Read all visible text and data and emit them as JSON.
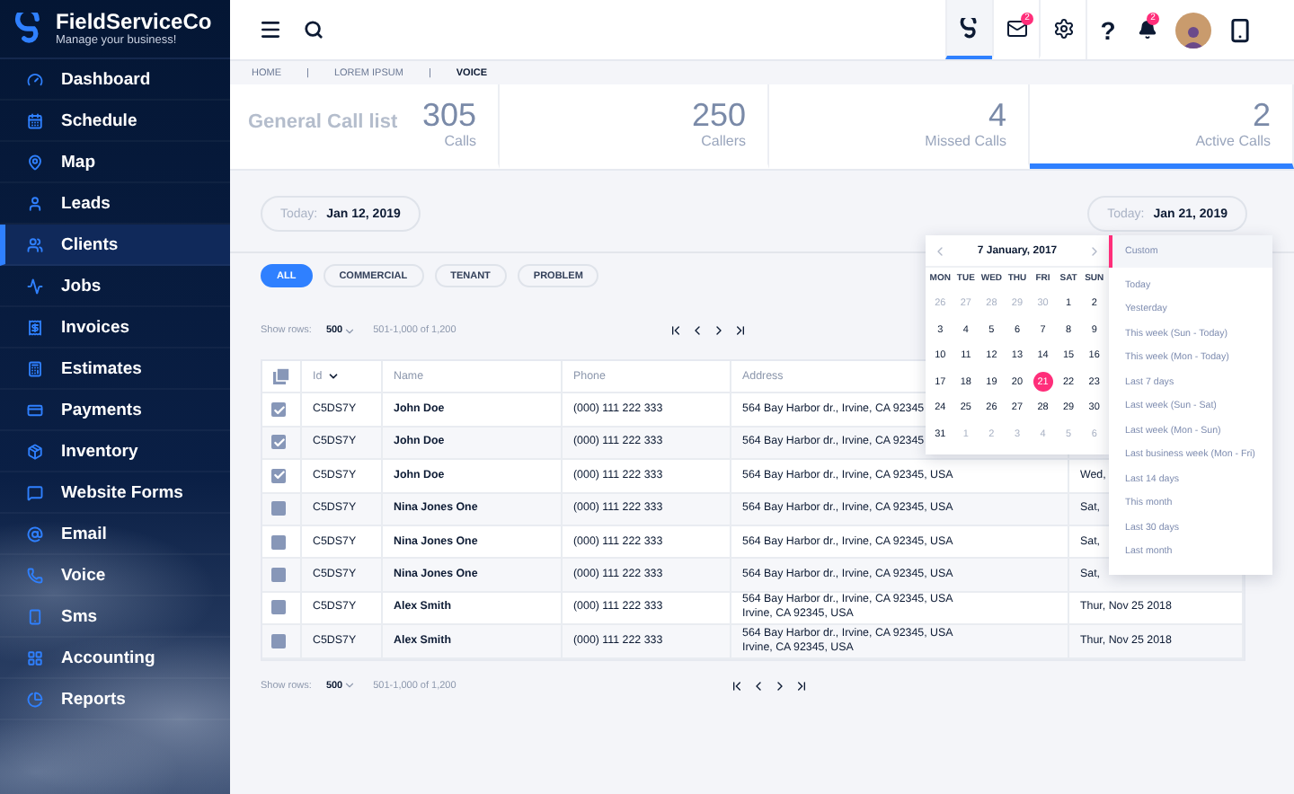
{
  "brand": {
    "name": "FieldServiceCo",
    "tagline": "Manage your business!"
  },
  "sidebar": {
    "items": [
      {
        "label": "Dashboard",
        "selected": false
      },
      {
        "label": "Schedule",
        "selected": false
      },
      {
        "label": "Map",
        "selected": false
      },
      {
        "label": "Leads",
        "selected": false
      },
      {
        "label": "Clients",
        "selected": true
      },
      {
        "label": "Jobs",
        "selected": false
      },
      {
        "label": "Invoices",
        "selected": false
      },
      {
        "label": "Estimates",
        "selected": false
      },
      {
        "label": "Payments",
        "selected": false
      },
      {
        "label": "Inventory",
        "selected": false
      },
      {
        "label": "Website Forms",
        "selected": false
      },
      {
        "label": "Email",
        "selected": false
      },
      {
        "label": "Voice",
        "selected": false
      },
      {
        "label": "Sms",
        "selected": false
      },
      {
        "label": "Accounting",
        "selected": false
      },
      {
        "label": "Reports",
        "selected": false
      }
    ]
  },
  "topbar": {
    "items": [
      {
        "kind": "logo",
        "selected": true
      },
      {
        "kind": "mail",
        "badge": "2",
        "selected": false
      },
      {
        "kind": "settings",
        "selected": false
      },
      {
        "kind": "help",
        "label": "?"
      },
      {
        "kind": "bell",
        "badge": "2"
      },
      {
        "kind": "avatar"
      },
      {
        "kind": "phone"
      }
    ]
  },
  "breadcrumb": {
    "separator": "|",
    "items": [
      {
        "label": "HOME",
        "current": false
      },
      {
        "label": "LOREM IPSUM",
        "current": false
      },
      {
        "label": "VOICE",
        "current": true
      }
    ]
  },
  "stats": {
    "title": "General Call list",
    "cards": [
      {
        "value": "305",
        "label": "Calls",
        "selected": false
      },
      {
        "value": "250",
        "label": "Callers",
        "selected": false
      },
      {
        "value": "4",
        "label": "Missed Calls",
        "selected": false
      },
      {
        "value": "2",
        "label": "Active Calls",
        "selected": true
      }
    ]
  },
  "date_range": {
    "start": {
      "prefix": "Today:",
      "date": "Jan 12, 2019"
    },
    "end": {
      "prefix": "Today:",
      "date": "Jan 21, 2019"
    }
  },
  "filters": [
    {
      "label": "ALL",
      "selected": true
    },
    {
      "label": "COMMERCIAL",
      "selected": false
    },
    {
      "label": "TENANT",
      "selected": false
    },
    {
      "label": "PROBLEM",
      "selected": false
    }
  ],
  "pager_top": {
    "label": "Show rows:",
    "rows": "500",
    "range": "501-1,000 of 1,200"
  },
  "table": {
    "columns": [
      "Id",
      "Name",
      "Phone",
      "Address"
    ],
    "rows": [
      {
        "checked": true,
        "id": "C5DS7Y",
        "name": "John Doe",
        "phone": "(000) 111 222 333",
        "address": [
          "564 Bay Harbor dr., Irvine, CA 92345"
        ]
      },
      {
        "checked": true,
        "id": "C5DS7Y",
        "name": "John Doe",
        "phone": "(000) 111 222 333",
        "address": [
          "564 Bay Harbor dr., Irvine, CA 92345"
        ]
      },
      {
        "checked": true,
        "id": "C5DS7Y",
        "name": "John Doe",
        "phone": "(000) 111 222 333",
        "address": [
          "564 Bay Harbor dr., Irvine, CA 92345, USA"
        ],
        "date": "Wed,"
      },
      {
        "checked": false,
        "id": "C5DS7Y",
        "name": "Nina Jones One",
        "phone": "(000) 111 222 333",
        "address": [
          "564 Bay Harbor dr., Irvine, CA 92345, USA"
        ],
        "date": "Sat,"
      },
      {
        "checked": false,
        "id": "C5DS7Y",
        "name": "Nina Jones One",
        "phone": "(000) 111 222 333",
        "address": [
          "564 Bay Harbor dr., Irvine, CA 92345, USA"
        ],
        "date": "Sat,"
      },
      {
        "checked": false,
        "id": "C5DS7Y",
        "name": "Nina Jones One",
        "phone": "(000) 111 222 333",
        "address": [
          "564 Bay Harbor dr., Irvine, CA 92345, USA"
        ],
        "date": "Sat,"
      },
      {
        "checked": false,
        "id": "C5DS7Y",
        "name": "Alex Smith",
        "phone": "(000) 111 222 333",
        "address": [
          "564 Bay Harbor dr., Irvine, CA 92345, USA",
          "Irvine, CA 92345, USA"
        ],
        "date": "Thur, Nov 25 2018"
      },
      {
        "checked": false,
        "id": "C5DS7Y",
        "name": "Alex Smith",
        "phone": "(000) 111 222 333",
        "address": [
          "564 Bay Harbor dr., Irvine, CA 92345, USA",
          "Irvine, CA 92345, USA"
        ],
        "date": "Thur, Nov 25 2018"
      }
    ]
  },
  "pager_bottom": {
    "label": "Show rows:",
    "rows": "500",
    "range": "501-1,000 of 1,200"
  },
  "calendar": {
    "title": "7 January, 2017",
    "weekdays": [
      "MON",
      "TUE",
      "WED",
      "THU",
      "FRI",
      "SAT",
      "SUN"
    ],
    "weeks": [
      [
        {
          "d": "26",
          "muted": true,
          "selected": false
        },
        {
          "d": "27",
          "muted": true,
          "selected": false
        },
        {
          "d": "28",
          "muted": true,
          "selected": false
        },
        {
          "d": "29",
          "muted": true,
          "selected": false
        },
        {
          "d": "30",
          "muted": true,
          "selected": false
        },
        {
          "d": "1",
          "muted": false,
          "selected": false
        },
        {
          "d": "2",
          "muted": false,
          "selected": false
        }
      ],
      [
        {
          "d": "3",
          "muted": false,
          "selected": false
        },
        {
          "d": "4",
          "muted": false,
          "selected": false
        },
        {
          "d": "5",
          "muted": false,
          "selected": false
        },
        {
          "d": "6",
          "muted": false,
          "selected": false
        },
        {
          "d": "7",
          "muted": false,
          "selected": false
        },
        {
          "d": "8",
          "muted": false,
          "selected": false
        },
        {
          "d": "9",
          "muted": false,
          "selected": false
        }
      ],
      [
        {
          "d": "10",
          "muted": false,
          "selected": false
        },
        {
          "d": "11",
          "muted": false,
          "selected": false
        },
        {
          "d": "12",
          "muted": false,
          "selected": false
        },
        {
          "d": "13",
          "muted": false,
          "selected": false
        },
        {
          "d": "14",
          "muted": false,
          "selected": false
        },
        {
          "d": "15",
          "muted": false,
          "selected": false
        },
        {
          "d": "16",
          "muted": false,
          "selected": false
        }
      ],
      [
        {
          "d": "17",
          "muted": false,
          "selected": false
        },
        {
          "d": "18",
          "muted": false,
          "selected": false
        },
        {
          "d": "19",
          "muted": false,
          "selected": false
        },
        {
          "d": "20",
          "muted": false,
          "selected": false
        },
        {
          "d": "21",
          "muted": false,
          "selected": true
        },
        {
          "d": "22",
          "muted": false,
          "selected": false
        },
        {
          "d": "23",
          "muted": false,
          "selected": false
        }
      ],
      [
        {
          "d": "24",
          "muted": false,
          "selected": false
        },
        {
          "d": "25",
          "muted": false,
          "selected": false
        },
        {
          "d": "26",
          "muted": false,
          "selected": false
        },
        {
          "d": "27",
          "muted": false,
          "selected": false
        },
        {
          "d": "28",
          "muted": false,
          "selected": false
        },
        {
          "d": "29",
          "muted": false,
          "selected": false
        },
        {
          "d": "30",
          "muted": false,
          "selected": false
        }
      ],
      [
        {
          "d": "31",
          "muted": false,
          "selected": false
        },
        {
          "d": "1",
          "muted": true,
          "selected": false
        },
        {
          "d": "2",
          "muted": true,
          "selected": false
        },
        {
          "d": "3",
          "muted": true,
          "selected": false
        },
        {
          "d": "4",
          "muted": true,
          "selected": false
        },
        {
          "d": "5",
          "muted": true,
          "selected": false
        },
        {
          "d": "6",
          "muted": true,
          "selected": false
        }
      ]
    ]
  },
  "presets": [
    {
      "label": "Custom",
      "selected": true
    },
    {
      "label": "Today",
      "selected": false
    },
    {
      "label": "Yesterday",
      "selected": false
    },
    {
      "label": "This week (Sun - Today)",
      "selected": false
    },
    {
      "label": "This week (Mon - Today)",
      "selected": false
    },
    {
      "label": "Last 7 days",
      "selected": false
    },
    {
      "label": "Last week (Sun - Sat)",
      "selected": false
    },
    {
      "label": "Last week (Mon - Sun)",
      "selected": false
    },
    {
      "label": "Last business week (Mon - Fri)",
      "selected": false
    },
    {
      "label": "Last 14 days",
      "selected": false
    },
    {
      "label": "This month",
      "selected": false
    },
    {
      "label": "Last 30 days",
      "selected": false
    },
    {
      "label": "Last month",
      "selected": false
    }
  ]
}
